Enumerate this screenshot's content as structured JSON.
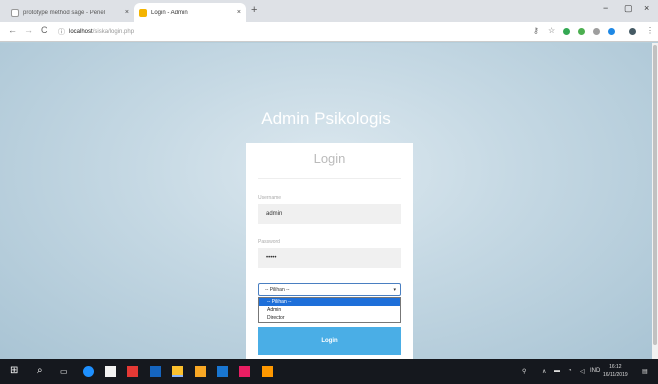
{
  "browser": {
    "tabs": [
      {
        "title": "prototype method sage - Penel",
        "active": false,
        "favicon_color": "#ffffff"
      },
      {
        "title": "Login - Admin",
        "active": true,
        "favicon_color": "#f4b400"
      }
    ],
    "tab_close": "×",
    "new_tab": "+",
    "window_controls": {
      "minimize": "−",
      "maximize": "▢",
      "close": "×"
    },
    "nav": {
      "back": "←",
      "forward": "→",
      "reload": "C"
    },
    "address": {
      "info_icon": "ⓘ",
      "host": "localhost",
      "path": "/siska/login.php"
    },
    "icons": [
      "key-icon",
      "star-icon",
      "extension-icons",
      "profile-icon",
      "menu-icon"
    ]
  },
  "page": {
    "brand": "Admin Psikologis",
    "card_title": "Login",
    "username_label": "Username",
    "username_value": "admin",
    "password_label": "Password",
    "password_value": "•••••",
    "role_select": {
      "selected": "-- Pilihan --",
      "caret": "▾",
      "options": [
        "-- Pilihan --",
        "Admin",
        "Director"
      ]
    },
    "login_button": "Login"
  },
  "taskbar": {
    "clock_time": "16:12",
    "clock_date": "16/11/2019",
    "tray_lang": "IND"
  },
  "colors": {
    "accent": "#4aaee6",
    "selection": "#1e6fd9",
    "background": "#b5cedb"
  }
}
